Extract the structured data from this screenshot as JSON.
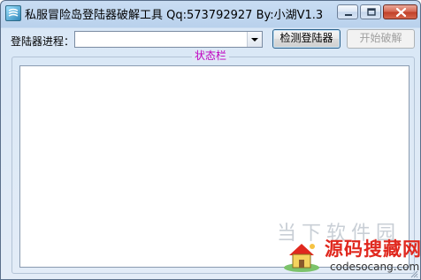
{
  "window": {
    "title": "私服冒险岛登陆器破解工具  Qq:573792927  By:小湖V1.3"
  },
  "toolbar": {
    "process_label": "登陆器进程：",
    "process_value": "",
    "detect_button": "检测登陆器",
    "crack_button": "开始破解"
  },
  "status": {
    "legend": "状态栏",
    "content": ""
  },
  "watermark": {
    "faded_text": "当下软件园",
    "title": "源码搜藏网",
    "url": "codesocang.com"
  },
  "colors": {
    "legend": "#c000c0",
    "watermark_red": "#e0281e",
    "close_button": "#c2412a"
  },
  "icons": {
    "app": "app-icon",
    "minimize": "minimize-icon",
    "maximize": "maximize-icon",
    "close": "close-icon",
    "dropdown": "chevron-down-icon",
    "watermark_logo": "house-logo-icon"
  }
}
